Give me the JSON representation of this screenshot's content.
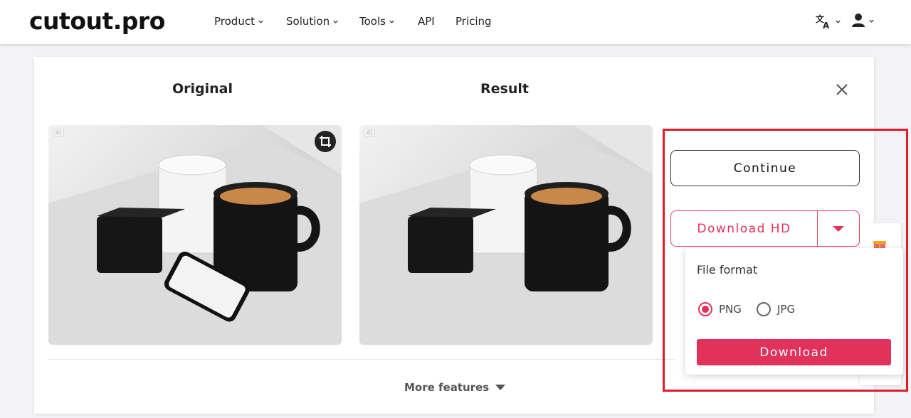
{
  "header": {
    "logo": "cutout.pro",
    "nav": [
      {
        "label": "Product"
      },
      {
        "label": "Solution"
      },
      {
        "label": "Tools"
      },
      {
        "label": "API"
      },
      {
        "label": "Pricing"
      }
    ],
    "icons": {
      "language": "translate-icon",
      "user": "user-icon"
    }
  },
  "editor": {
    "original_title": "Original",
    "result_title": "Result",
    "ai_tag": "AI",
    "more_features": "More features"
  },
  "actions": {
    "continue_label": "Continue",
    "download_hd_label": "Download HD",
    "accent_color": "#e1325b"
  },
  "format_popover": {
    "title": "File format",
    "options": [
      {
        "label": "PNG",
        "selected": true
      },
      {
        "label": "JPG",
        "selected": false
      }
    ],
    "download_label": "Download"
  }
}
